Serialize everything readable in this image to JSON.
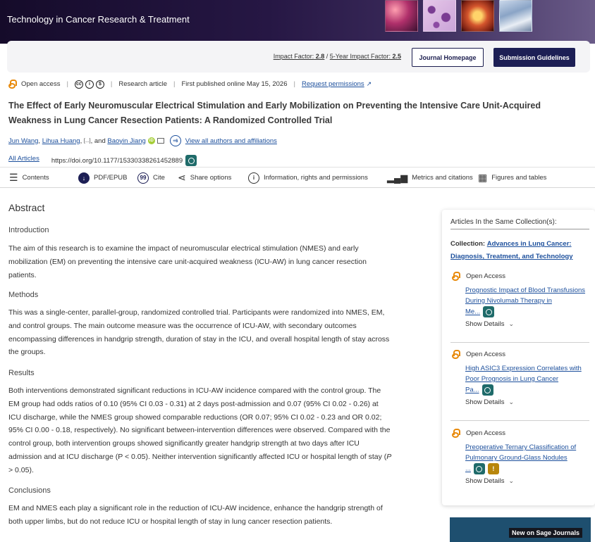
{
  "banner": {
    "journal_title": "Technology in Cancer Research & Treatment"
  },
  "journal_bar": {
    "impact_label": "Impact Factor:",
    "impact_value": "2.8",
    "five_year_label": "5-Year Impact Factor:",
    "five_year_value": "2.5",
    "homepage_button": "Journal Homepage",
    "submission_button": "Submission Guidelines"
  },
  "meta": {
    "open_access": "Open access",
    "article_type": "Research article",
    "published": "First published online May 15, 2026",
    "permissions": "Request permissions"
  },
  "article": {
    "title": "The Effect of Early Neuromuscular Electrical Stimulation and Early Mobilization on Preventing the Intensive Care Unit-Acquired Weakness in Lung Cancer Resection Patients: A Randomized Controlled Trial",
    "author1": "Jun Wang",
    "author2": "Lihua Huang",
    "ellipsis": "[...]",
    "and": "and",
    "author3": "Baoyin Jiang",
    "more_authors": "+6",
    "view_all": "View all authors and affiliations",
    "all_articles": "All Articles",
    "doi": "https://doi.org/10.1177/15330338261452889"
  },
  "toolbar": {
    "contents": "Contents",
    "pdf": "PDF/EPUB",
    "cite": "Cite",
    "share": "Share options",
    "info": "Information, rights and permissions",
    "metrics": "Metrics and citations",
    "figures": "Figures and tables"
  },
  "abstract": {
    "heading": "Abstract",
    "intro_h": "Introduction",
    "intro": "The aim of this research is to examine the impact of neuromuscular electrical stimulation (NMES) and early mobilization (EM) on preventing the intensive care unit-acquired weakness (ICU-AW) in lung cancer resection patients.",
    "methods_h": "Methods",
    "methods": "This was a single-center, parallel-group, randomized controlled trial. Participants were randomized into NMES, EM, and control groups. The main outcome measure was the occurrence of ICU-AW, with secondary outcomes encompassing differences in handgrip strength, duration of stay in the ICU, and overall hospital length of stay across the groups.",
    "results_h": "Results",
    "results": "Both interventions demonstrated significant reductions in ICU-AW incidence compared with the control group. The EM group had odds ratios of 0.10 (95% CI 0.03 - 0.31) at 2 days post-admission and 0.07 (95% CI 0.02 - 0.26) at ICU discharge, while the NMES group showed comparable reductions (OR 0.07; 95% CI 0.02 - 0.23 and OR 0.02; 95% CI 0.00 - 0.18, respectively). No significant between-intervention differences were observed. Compared with the control group, both intervention groups showed significantly greater handgrip strength at two days after ICU admission and at ICU discharge (P < 0.05). Neither intervention significantly affected ICU or hospital length of stay (",
    "results_p": "P",
    "results_end": " > 0.05).",
    "conclusions_h": "Conclusions",
    "conclusions": "EM and NMES each play a significant role in the reduction of ICU-AW incidence, enhance the handgrip strength of both upper limbs, but do not reduce ICU or hospital length of stay in lung cancer resection patients."
  },
  "sidebar": {
    "heading": "Articles In the Same Collection(s):",
    "collection_label": "Collection:",
    "collection_name": "Advances in Lung Cancer: Diagnosis, Treatment, and Technology",
    "open_access": "Open Access",
    "show_details": "Show Details",
    "articles": [
      {
        "title_l1": "Prognostic Impact of Blood Transfusions",
        "title_l2": "During Nivolumab Therapy in",
        "title_l3": "Me..."
      },
      {
        "title_l1": "High ASIC3 Expression Correlates with",
        "title_l2": "Poor Prognosis in Lung Cancer",
        "title_l3": "Pa..."
      },
      {
        "title_l1": "Preoperative Ternary Classification of",
        "title_l2": "Pulmonary Ground-Glass Nodules",
        "title_l3": "..."
      }
    ]
  },
  "promo": {
    "tag": "New on Sage Journals"
  }
}
